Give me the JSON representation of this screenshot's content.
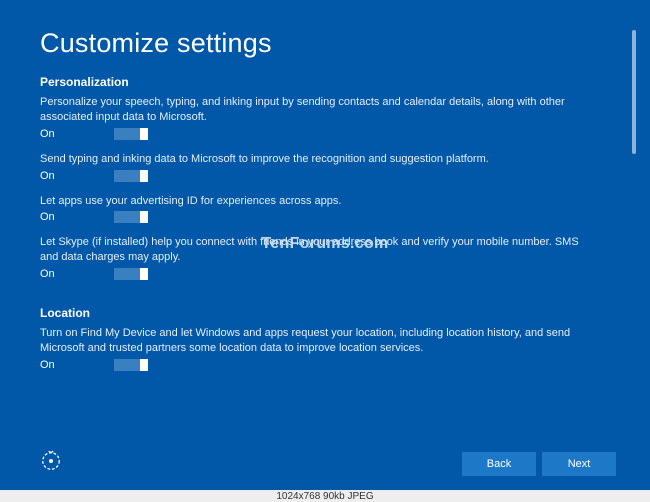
{
  "page_title": "Customize settings",
  "sections": {
    "personalization": {
      "heading": "Personalization",
      "items": [
        {
          "desc": "Personalize your speech, typing, and inking input by sending contacts and calendar details, along with other associated input data to Microsoft.",
          "state": "On"
        },
        {
          "desc": "Send typing and inking data to Microsoft to improve the recognition and suggestion platform.",
          "state": "On"
        },
        {
          "desc": "Let apps use your advertising ID for experiences across apps.",
          "state": "On"
        },
        {
          "desc": "Let Skype (if installed) help you connect with friends in your address book and verify your mobile number. SMS and data charges may apply.",
          "state": "On"
        }
      ]
    },
    "location": {
      "heading": "Location",
      "items": [
        {
          "desc": "Turn on Find My Device and let Windows and apps request your location, including location history, and send Microsoft and trusted partners some location data to improve location services.",
          "state": "On"
        }
      ]
    }
  },
  "buttons": {
    "back": "Back",
    "next": "Next"
  },
  "watermark": "TenForums.com",
  "meta": "1024x768   90kb   JPEG"
}
